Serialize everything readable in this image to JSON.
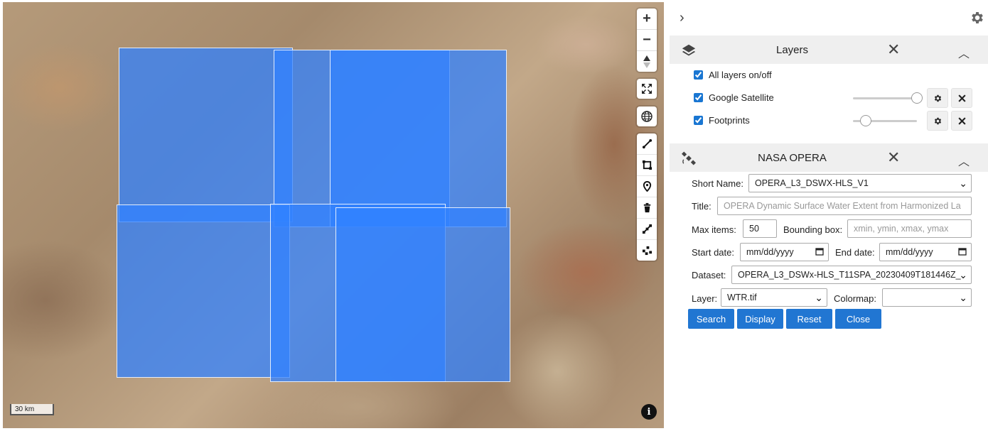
{
  "map": {
    "zoom_in": "+",
    "zoom_out": "−",
    "scale_label": "30 km",
    "info_label": "i",
    "icons": [
      "plus-icon",
      "minus-icon",
      "compass-icon",
      "fullscreen-icon",
      "globe-icon",
      "polyline-icon",
      "rectangle-icon",
      "marker-icon",
      "trash-icon",
      "edit-icon",
      "move-icon",
      "info-icon"
    ]
  },
  "panel": {
    "expand_icon": "›",
    "layers": {
      "title": "Layers",
      "close": "✕",
      "collapse": "︿",
      "all_toggle": "All layers on/off",
      "items": [
        {
          "name": "Google Satellite",
          "checked": true,
          "opacity": 1.0
        },
        {
          "name": "Footprints",
          "checked": true,
          "opacity": 0.2
        }
      ]
    },
    "opera": {
      "title": "NASA OPERA",
      "close": "✕",
      "collapse": "︿",
      "short_name_label": "Short Name:",
      "short_name_value": "OPERA_L3_DSWX-HLS_V1",
      "title_label": "Title:",
      "title_placeholder": "OPERA Dynamic Surface Water Extent from Harmonized La",
      "max_items_label": "Max items:",
      "max_items_value": "50",
      "bbox_label": "Bounding box:",
      "bbox_placeholder": "xmin, ymin, xmax, ymax",
      "start_date_label": "Start date:",
      "start_date_value": "mm/dd/yyyy",
      "end_date_label": "End date:",
      "end_date_value": "mm/dd/yyyy",
      "dataset_label": "Dataset:",
      "dataset_value": "OPERA_L3_DSWx-HLS_T11SPA_20230409T181446Z_",
      "layer_label": "Layer:",
      "layer_value": "WTR.tif",
      "colormap_label": "Colormap:",
      "colormap_value": "",
      "buttons": {
        "search": "Search",
        "display": "Display",
        "reset": "Reset",
        "close": "Close"
      }
    }
  },
  "colors": {
    "accent": "#2176d2",
    "footprint": "#3282ff"
  }
}
